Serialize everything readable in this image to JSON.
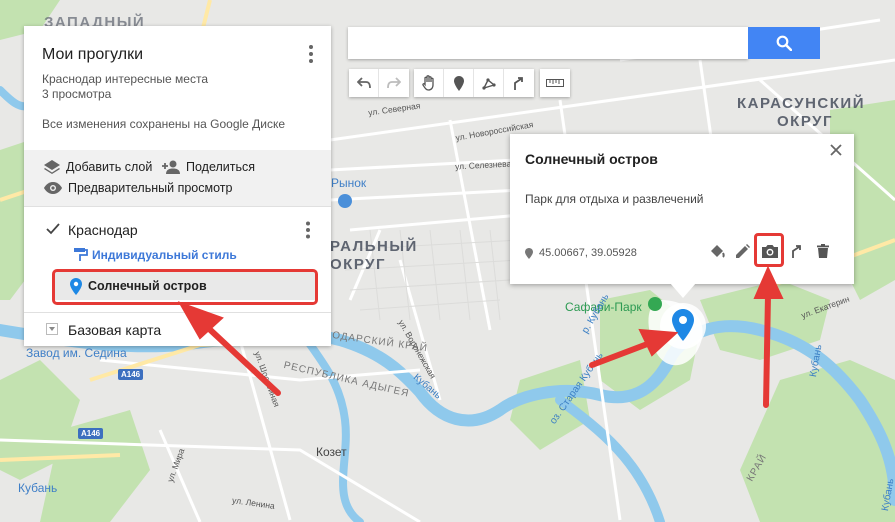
{
  "colors": {
    "accent": "#4285f4",
    "highlight": "#e53935",
    "marker": "#1e88e5",
    "water": "#8fc9ec",
    "park": "#c3e2b0"
  },
  "panel": {
    "title": "Мои прогулки",
    "subtitle": "Краснодар интересные места",
    "views": "3 просмотра",
    "saved": "Все изменения сохранены на Google Диске",
    "add_layer": "Добавить слой",
    "share": "Поделиться",
    "preview": "Предварительный просмотр",
    "layer": {
      "name": "Краснодар",
      "checked": true,
      "style": "Индивидуальный стиль",
      "item": "Солнечный остров"
    },
    "base_map": "Базовая карта"
  },
  "search": {
    "value": "",
    "placeholder": ""
  },
  "toolbar": [
    "undo-icon",
    "redo-icon",
    "hand-icon",
    "marker-icon",
    "line-icon",
    "directions-icon",
    "ruler-icon"
  ],
  "popup": {
    "title": "Солнечный остров",
    "description": "Парк для отдыха и развлечений",
    "coords": "45.00667, 39.05928",
    "actions": [
      "paint-icon",
      "edit-icon",
      "camera-icon",
      "directions-icon",
      "delete-icon"
    ]
  },
  "map": {
    "labels": {
      "zapadny": "ЗАПАДНЫЙ",
      "karasunsky": "КАРАСУНСКИЙ",
      "okrug1": "ОКРУГ",
      "tsentralny": "РАЛЬНЫЙ",
      "okrug2": "ОКРУГ",
      "rynok": "Рынок",
      "safari": "Сафари-Парк",
      "zavod": "Завод им. Седина",
      "kuban": "Кубань",
      "kozet": "Козет",
      "respublika": "РЕСПУБЛИКА АДЫГЕЯ",
      "krasnodarsky": "ОДАРСКИЙ КРАЙ",
      "krasnodarsky2": "КРАЙ",
      "staraya_kuban": "оз. Старая Кубань",
      "kuban_river": "Кубань",
      "kuban_river2": "Кубань",
      "kuban_river3": "Кубань",
      "reka": "р. Кубань",
      "a146a": "A146",
      "a146b": "A146"
    },
    "streets": {
      "severnaya": "ул. Северная",
      "novorossiyskaya": "ул. Новороссийская",
      "selezneva": "ул. Селезнева",
      "voronezhskaya": "ул. Воронежская",
      "shosseynaya": "ул. Шоссейная",
      "mira": "ул. Мира",
      "lenina": "ул. Ленина",
      "ekaterin": "ул. Екатерин"
    }
  }
}
